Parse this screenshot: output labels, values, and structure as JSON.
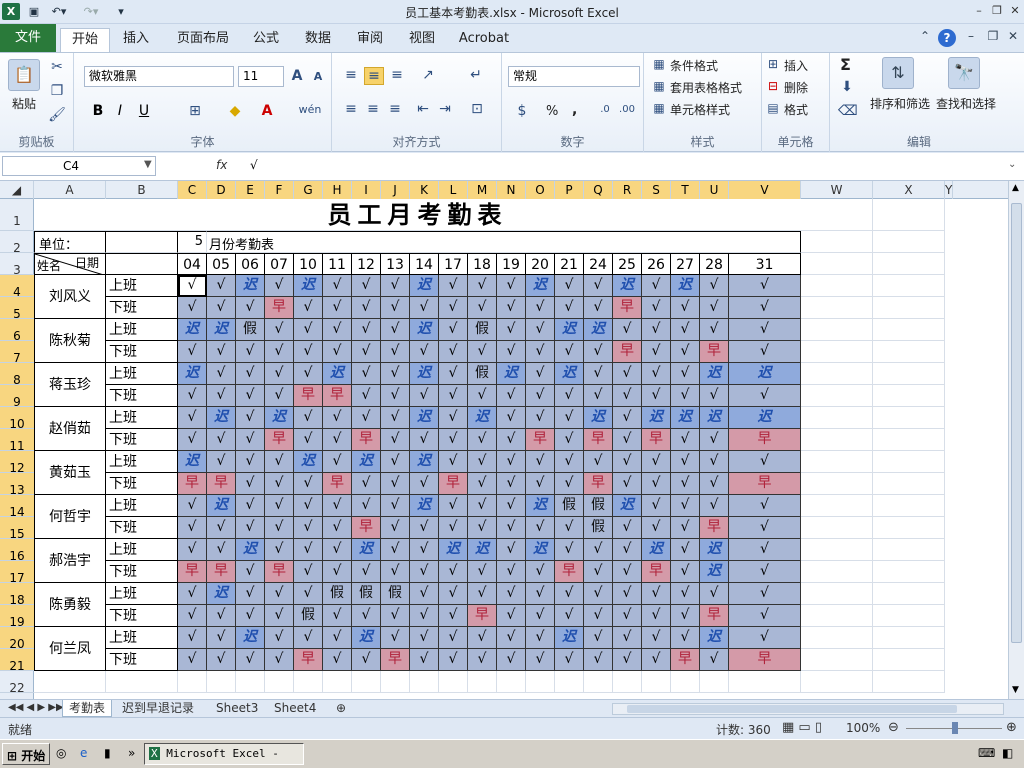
{
  "window": {
    "title": "员工基本考勤表.xlsx - Microsoft Excel"
  },
  "tabs": [
    "文件",
    "开始",
    "插入",
    "页面布局",
    "公式",
    "数据",
    "审阅",
    "视图",
    "Acrobat"
  ],
  "ribbon": {
    "clipboard": {
      "label": "剪贴板",
      "paste": "粘贴"
    },
    "font": {
      "label": "字体",
      "name": "微软雅黑",
      "size": "11"
    },
    "align": {
      "label": "对齐方式"
    },
    "number": {
      "label": "数字",
      "format": "常规",
      "percent": "%",
      "comma": ","
    },
    "styles": {
      "label": "样式",
      "cond": "条件格式",
      "table": "套用表格格式",
      "cell": "单元格样式"
    },
    "cells": {
      "label": "单元格",
      "insert": "插入",
      "delete": "删除",
      "format": "格式"
    },
    "edit": {
      "label": "编辑",
      "sort": "排序和筛选",
      "find": "查找和选择",
      "sigma": "Σ"
    }
  },
  "formula": {
    "name": "C4",
    "fx": "fx",
    "content": "√"
  },
  "columns": [
    "A",
    "B",
    "C",
    "D",
    "E",
    "F",
    "G",
    "H",
    "I",
    "J",
    "K",
    "L",
    "M",
    "N",
    "O",
    "P",
    "Q",
    "R",
    "S",
    "T",
    "U",
    "V",
    "W",
    "X",
    "Y"
  ],
  "rows": [
    "1",
    "2",
    "3",
    "4",
    "5",
    "6",
    "7",
    "8",
    "9",
    "10",
    "11",
    "12",
    "13",
    "14",
    "15",
    "16",
    "17",
    "18",
    "19",
    "20",
    "21",
    "22"
  ],
  "sheet": {
    "title": "员工月考勤表",
    "unit": "单位：",
    "month": "5",
    "monthLabel": "月份考勤表",
    "diagDate": "日期",
    "diagName": "姓名",
    "days": [
      "04",
      "05",
      "06",
      "07",
      "10",
      "11",
      "12",
      "13",
      "14",
      "17",
      "18",
      "19",
      "20",
      "21",
      "24",
      "25",
      "26",
      "27",
      "28",
      "31"
    ],
    "shiftOn": "上班",
    "shiftOff": "下班",
    "employees": [
      "刘风义",
      "陈秋菊",
      "蒋玉珍",
      "赵俏茹",
      "黄茹玉",
      "何哲宇",
      "郝浩宇",
      "陈勇毅",
      "何兰凤"
    ],
    "marks": {
      "ok": "√",
      "late": "迟",
      "early": "早",
      "leave": "假"
    },
    "grid": [
      "ooLoLoooLoooLooLoL",
      "oooEoooooooooooEoo",
      "LLPoooooLoPooLLooooo",
      "oooooooooooooooEooEo",
      "LooooLooLoPLoLooooLL",
      "ooooEEoooooooooooooo",
      "oLoLooooLoLoooLoLLLL",
      "oooEooEoooooEoEoEooE",
      "LoooLoLoLooooooooooo",
      "EEoooEoooEooooEooooE",
      "oLooooooLoooLPPLooooo",
      "ooooooEoooooooPoooEo",
      "ooLoooLooLLoLoooLoLo",
      "EEoEoooooooooEooEoLo",
      "oLoooPPPooooooooooo",
      "ooooPoooooEoooooooEo",
      "ooLoooLooooooLooooLo",
      "ooooEooEoooooooooEoE"
    ]
  },
  "sheetTabs": [
    "考勤表",
    "迟到早退记录",
    "Sheet3",
    "Sheet4"
  ],
  "status": {
    "ready": "就绪",
    "count": "计数: 360",
    "zoom": "100%"
  },
  "taskbar": {
    "start": "开始",
    "app": "Microsoft Excel - ..."
  }
}
